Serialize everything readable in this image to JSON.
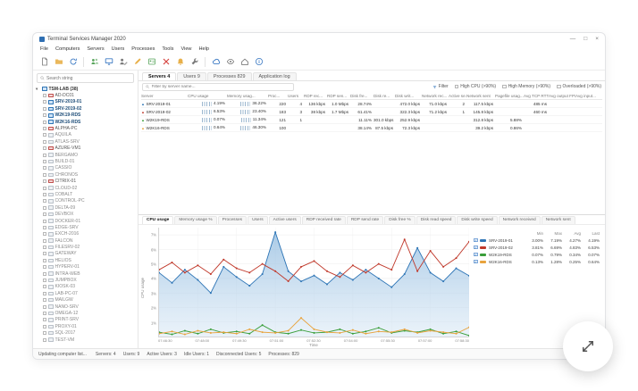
{
  "window": {
    "title": "Terminal Services Manager 2020",
    "controls": {
      "minimize": "—",
      "maximize": "□",
      "close": "×"
    }
  },
  "menu": {
    "items": [
      "File",
      "Computers",
      "Servers",
      "Users",
      "Processes",
      "Tools",
      "View",
      "Help"
    ]
  },
  "toolbar": {
    "items": [
      {
        "name": "new-document-icon",
        "icon": "new-document",
        "color": "#7a7a7a"
      },
      {
        "name": "open-folder-icon",
        "icon": "open-folder",
        "color": "#e8b04a"
      },
      {
        "name": "refresh-icon",
        "icon": "refresh",
        "color": "#3b79c3"
      },
      {
        "sep": true
      },
      {
        "name": "users-icon",
        "icon": "users",
        "color": "#58a55c"
      },
      {
        "name": "computer-icon",
        "icon": "monitor",
        "color": "#3b79c3"
      },
      {
        "name": "user-edit-icon",
        "icon": "user-edit",
        "color": "#7a7a7a"
      },
      {
        "name": "pencil-icon",
        "icon": "pencil",
        "color": "#e8b04a"
      },
      {
        "name": "id-badge-icon",
        "icon": "badge",
        "color": "#58a55c"
      },
      {
        "name": "delete-icon",
        "icon": "delete",
        "color": "#d64541"
      },
      {
        "name": "bell-icon",
        "icon": "bell",
        "color": "#e8b04a"
      },
      {
        "name": "wrench-icon",
        "icon": "wrench",
        "color": "#7a7a7a"
      },
      {
        "sep": true
      },
      {
        "name": "cloud-icon",
        "icon": "cloud",
        "color": "#3b79c3"
      },
      {
        "name": "shadow-eye-icon",
        "icon": "eye",
        "color": "#7a7a7a"
      },
      {
        "name": "home-icon",
        "icon": "home",
        "color": "#7a7a7a"
      },
      {
        "name": "info-icon",
        "icon": "info",
        "color": "#3b79c3"
      }
    ]
  },
  "sidebar": {
    "search_placeholder": "Search string",
    "tree": {
      "root_label": "TSM-LAB (38)",
      "items": [
        {
          "label": "AD-DC01",
          "state": "error"
        },
        {
          "label": "SRV-2019-01",
          "state": "online"
        },
        {
          "label": "SRV-2019-02",
          "state": "online"
        },
        {
          "label": "W2K19-RDS",
          "state": "online"
        },
        {
          "label": "W2K16-RDS",
          "state": "online"
        },
        {
          "label": "ALPHA-PC",
          "state": "error"
        },
        {
          "label": "AQUILA",
          "state": "offline"
        },
        {
          "label": "ATLAS-SRV",
          "state": "offline"
        },
        {
          "label": "AZURE-VM1",
          "state": "error"
        },
        {
          "label": "BERGAMO",
          "state": "offline"
        },
        {
          "label": "BUILD-01",
          "state": "offline"
        },
        {
          "label": "CASSIO",
          "state": "offline"
        },
        {
          "label": "CHRONOS",
          "state": "offline"
        },
        {
          "label": "CITRIX-01",
          "state": "error"
        },
        {
          "label": "CLOUD-02",
          "state": "offline"
        },
        {
          "label": "COBALT",
          "state": "offline"
        },
        {
          "label": "CONTROL-PC",
          "state": "offline"
        },
        {
          "label": "DELTA-09",
          "state": "offline"
        },
        {
          "label": "DEVBOX",
          "state": "offline"
        },
        {
          "label": "DOCKER-01",
          "state": "offline"
        },
        {
          "label": "EDGE-SRV",
          "state": "offline"
        },
        {
          "label": "EXCH-2016",
          "state": "offline"
        },
        {
          "label": "FALCON",
          "state": "offline"
        },
        {
          "label": "FILESRV-02",
          "state": "offline"
        },
        {
          "label": "GATEWAY",
          "state": "offline"
        },
        {
          "label": "HELIOS",
          "state": "offline"
        },
        {
          "label": "HYPERV-01",
          "state": "offline"
        },
        {
          "label": "INTRA-WEB",
          "state": "offline"
        },
        {
          "label": "JUMPBOX",
          "state": "offline"
        },
        {
          "label": "KIOSK-03",
          "state": "offline"
        },
        {
          "label": "LAB-PC-07",
          "state": "offline"
        },
        {
          "label": "MAILGW",
          "state": "offline"
        },
        {
          "label": "NANO-SRV",
          "state": "offline"
        },
        {
          "label": "OMEGA-12",
          "state": "offline"
        },
        {
          "label": "PRINT-SRV",
          "state": "offline"
        },
        {
          "label": "PROXY-01",
          "state": "offline"
        },
        {
          "label": "SQL-2017",
          "state": "offline"
        },
        {
          "label": "TEST-VM",
          "state": "offline"
        }
      ]
    }
  },
  "main": {
    "tabs": [
      {
        "label": "Servers 4",
        "active": true
      },
      {
        "label": "Users 9",
        "active": false
      },
      {
        "label": "Processes 829",
        "active": false
      },
      {
        "label": "Application log",
        "active": false
      }
    ],
    "filter": {
      "placeholder": "Filter by server name...",
      "filter_label": "Filter",
      "high_cpu": "High CPU (>90%)",
      "high_memory": "High Memory (>90%)",
      "overloaded": "Overloaded (>90%)"
    },
    "table": {
      "columns": [
        "Server",
        "CPU usage",
        "Memory usag...",
        "Proc...",
        "Users",
        "RDP rec...",
        "RDP sen...",
        "Disk fre...",
        "Disk re...",
        "Disk writ...",
        "Network rec...",
        "Active se...",
        "Network sent",
        "Pagefile usag...",
        "Avg TCP RTT",
        "Avg output FPS",
        "Avg input..."
      ],
      "rows": [
        {
          "server": "SRV-2019-01",
          "color": "#2e75b6",
          "cpu": "4.19%",
          "memory": "36.22%",
          "processes": "220",
          "users": "4",
          "rdp_received": "136 kbps",
          "rdp_sent": "1.0 Mbps",
          "disk_free": "28.74%",
          "disk_read": "",
          "disk_write": "472.0 kbps",
          "network_received": "71.0 kbps",
          "active_sessions": "2",
          "network_sent": "117.5 kbps",
          "pagefile": "",
          "avg_tcp_rtt": "485 ms",
          "avg_output_fps": "",
          "avg_input": ""
        },
        {
          "server": "SRV-2019-02",
          "color": "#c0392b",
          "cpu": "6.53%",
          "memory": "23.40%",
          "processes": "183",
          "users": "3",
          "rdp_received": "38 kbps",
          "rdp_sent": "1.7 Mbps",
          "disk_free": "61.41%",
          "disk_read": "",
          "disk_write": "322.3 kbps",
          "network_received": "71.2 kbps",
          "active_sessions": "1",
          "network_sent": "145.8 kbps",
          "pagefile": "",
          "avg_tcp_rtt": "460 ms",
          "avg_output_fps": "",
          "avg_input": ""
        },
        {
          "server": "W2K19-RDS",
          "color": "#3a9e3a",
          "cpu": "0.07%",
          "memory": "11.34%",
          "processes": "121",
          "users": "1",
          "rdp_received": "",
          "rdp_sent": "",
          "disk_free": "11.11%",
          "disk_read": "301.0 kbps",
          "disk_write": "252.9 kbps",
          "network_received": "",
          "active_sessions": "",
          "network_sent": "312.8 kbps",
          "pagefile": "5.88%",
          "avg_tcp_rtt": "",
          "avg_output_fps": "",
          "avg_input": ""
        },
        {
          "server": "W2K16-RDS",
          "color": "#e8a33d",
          "cpu": "0.64%",
          "memory": "46.30%",
          "processes": "100",
          "users": "",
          "rdp_received": "",
          "rdp_sent": "",
          "disk_free": "38.14%",
          "disk_read": "87.5 kbps",
          "disk_write": "72.3 kbps",
          "network_received": "",
          "active_sessions": "",
          "network_sent": "39.2 kbps",
          "pagefile": "0.86%",
          "avg_tcp_rtt": "",
          "avg_output_fps": "",
          "avg_input": ""
        }
      ]
    }
  },
  "chart": {
    "tabs": [
      "CPU usage",
      "Memory usage %",
      "Processes",
      "Users",
      "Active users",
      "RDP received rate",
      "RDP send rate",
      "Disk free %",
      "Disk read speed",
      "Disk write speed",
      "Network received",
      "Network sent"
    ],
    "active_tab": "CPU usage",
    "ylabel": "CPU usage",
    "xlabel": "Time",
    "legend": {
      "columns": [
        "Min",
        "Max",
        "Avg",
        "Last"
      ],
      "rows": [
        {
          "name": "SRV-2019-01",
          "color": "#2e75b6",
          "min": "3.00%",
          "max": "7.19%",
          "avg": "4.27%",
          "last": "4.19%"
        },
        {
          "name": "SRV-2019-02",
          "color": "#c0392b",
          "min": "3.81%",
          "max": "6.69%",
          "avg": "4.83%",
          "last": "6.53%"
        },
        {
          "name": "W2K19-RDS",
          "color": "#3a9e3a",
          "min": "0.07%",
          "max": "0.79%",
          "avg": "0.34%",
          "last": "0.07%"
        },
        {
          "name": "W2K16-RDS",
          "color": "#e8a33d",
          "min": "0.13%",
          "max": "1.28%",
          "avg": "0.25%",
          "last": "0.64%"
        }
      ]
    }
  },
  "chart_data": {
    "type": "line",
    "title": "CPU usage",
    "xlabel": "Time",
    "ylabel": "CPU usage",
    "ylim": [
      0,
      7.5
    ],
    "y_ticks": [
      7,
      6,
      5,
      4,
      3,
      2,
      1
    ],
    "y_tick_suffix": "%",
    "x_ticks": [
      "07:46:30",
      "07:48:00",
      "07:49:30",
      "07:51:00",
      "07:52:30",
      "07:54:00",
      "07:55:30",
      "07:57:00",
      "07:58:30"
    ],
    "series": [
      {
        "name": "SRV-2019-01",
        "color": "#2e75b6",
        "fill": true,
        "values": [
          4.4,
          3.7,
          4.6,
          3.9,
          3.0,
          4.8,
          4.1,
          3.5,
          4.3,
          7.19,
          4.5,
          3.8,
          4.2,
          3.6,
          4.4,
          3.9,
          4.6,
          4.0,
          3.4,
          4.3,
          6.1,
          4.4,
          3.8,
          4.7,
          4.19
        ]
      },
      {
        "name": "SRV-2019-02",
        "color": "#c0392b",
        "fill": false,
        "values": [
          4.6,
          5.1,
          4.4,
          4.9,
          4.3,
          5.3,
          4.7,
          4.4,
          5.0,
          4.5,
          3.81,
          4.8,
          5.2,
          4.5,
          4.1,
          4.9,
          4.4,
          5.0,
          4.6,
          6.69,
          4.5,
          5.9,
          4.8,
          5.4,
          6.53
        ]
      },
      {
        "name": "W2K19-RDS",
        "color": "#3a9e3a",
        "fill": false,
        "values": [
          0.3,
          0.15,
          0.4,
          0.2,
          0.5,
          0.25,
          0.35,
          0.2,
          0.79,
          0.3,
          0.2,
          0.45,
          0.25,
          0.3,
          0.5,
          0.2,
          0.35,
          0.6,
          0.25,
          0.4,
          0.3,
          0.5,
          0.2,
          0.35,
          0.07
        ]
      },
      {
        "name": "W2K16-RDS",
        "color": "#e8a33d",
        "fill": false,
        "values": [
          0.2,
          0.35,
          0.15,
          0.4,
          0.25,
          0.3,
          0.2,
          0.5,
          0.3,
          0.25,
          0.4,
          1.28,
          0.5,
          0.3,
          0.25,
          0.45,
          0.2,
          0.35,
          0.3,
          0.5,
          0.25,
          0.4,
          0.3,
          0.2,
          0.64
        ]
      }
    ]
  },
  "statusbar": {
    "left": "Updating computer list...",
    "items": [
      "Servers: 4",
      "Users: 9",
      "Active Users: 3",
      "Idle Users: 1",
      "Disconnected Users: 5",
      "Processes: 829"
    ]
  }
}
